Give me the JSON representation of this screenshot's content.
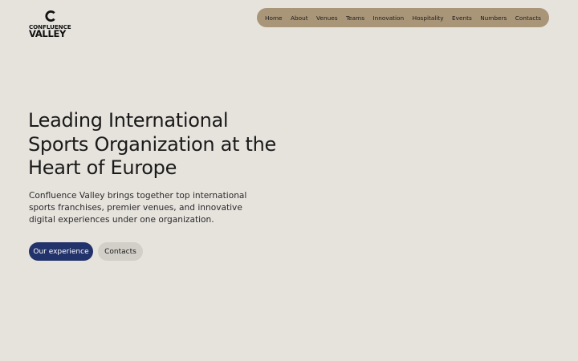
{
  "brand": {
    "logo_line1": "CONFLUENCE",
    "logo_line2": "VALLEY",
    "logo_icon": "c-mark-icon"
  },
  "nav": {
    "items": [
      {
        "label": "Home"
      },
      {
        "label": "About"
      },
      {
        "label": "Venues"
      },
      {
        "label": "Teams"
      },
      {
        "label": "Innovation"
      },
      {
        "label": "Hospitality"
      },
      {
        "label": "Events"
      },
      {
        "label": "Numbers"
      },
      {
        "label": "Contacts"
      }
    ]
  },
  "hero": {
    "title": "Leading International Sports Organization at the Heart of Europe",
    "description": "Confluence Valley brings together top international sports franchises, premier venues, and innovative digital experiences under one organization.",
    "primary_cta": "Our experience",
    "secondary_cta": "Contacts"
  },
  "colors": {
    "background": "#e6e3dd",
    "nav_pill": "#a99578",
    "primary_button": "#22326a",
    "secondary_button": "#d2cfc8",
    "text": "#1b1b1b"
  }
}
